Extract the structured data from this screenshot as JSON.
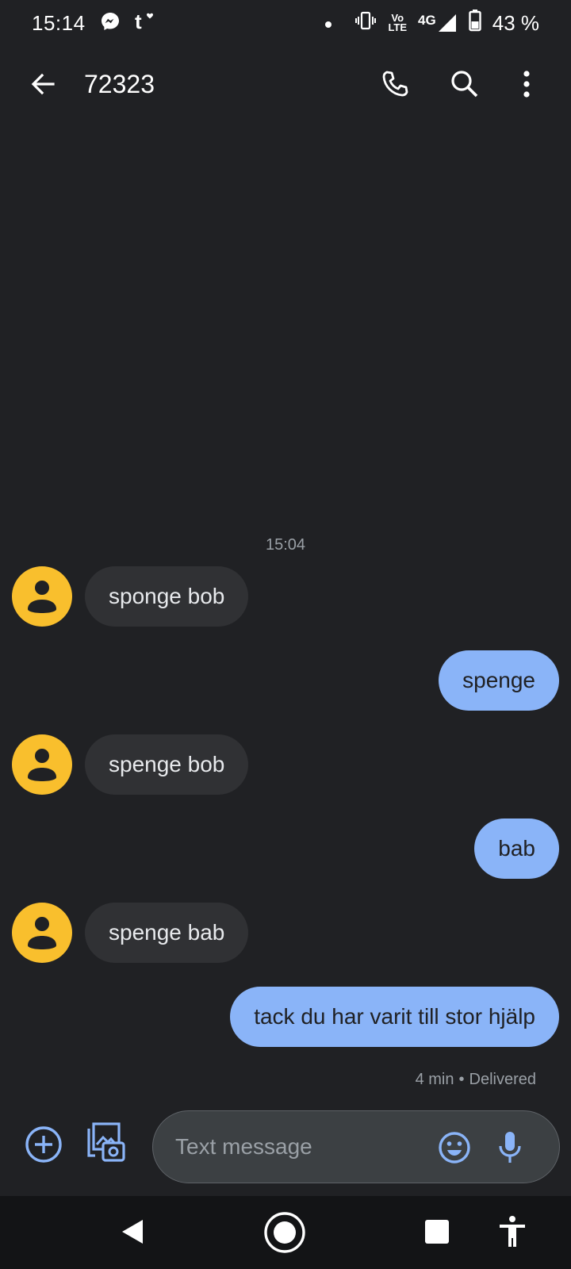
{
  "status_bar": {
    "time": "15:14",
    "network": "4G",
    "volte_top": "Vo",
    "volte_bottom": "LTE",
    "battery": "43 %",
    "icons": [
      "messenger-icon",
      "tumblr-icon",
      "dot-icon",
      "vibrate-icon",
      "volte-icon",
      "signal-icon",
      "battery-icon"
    ]
  },
  "app_bar": {
    "title": "72323",
    "icons": [
      "back-arrow-icon",
      "phone-icon",
      "search-icon",
      "more-vert-icon"
    ]
  },
  "conversation": {
    "timestamp": "15:04",
    "messages": [
      {
        "direction": "incoming",
        "text": "sponge bob"
      },
      {
        "direction": "outgoing",
        "text": "spenge"
      },
      {
        "direction": "incoming",
        "text": "spenge bob"
      },
      {
        "direction": "outgoing",
        "text": "bab"
      },
      {
        "direction": "incoming",
        "text": "spenge bab"
      },
      {
        "direction": "outgoing",
        "text": "tack du har varit till stor hjälp"
      }
    ],
    "delivery_time": "4 min",
    "delivery_separator": "•",
    "delivery_status": "Delivered"
  },
  "compose": {
    "placeholder": "Text message",
    "value": "",
    "icons": [
      "add-circle-icon",
      "media-gallery-icon",
      "emoji-icon",
      "microphone-icon"
    ]
  },
  "nav_bar": {
    "icons": [
      "nav-back-icon",
      "nav-home-icon",
      "nav-recents-icon",
      "accessibility-icon"
    ]
  },
  "colors": {
    "background": "#202124",
    "incoming_bubble": "#303134",
    "outgoing_bubble": "#8ab4f8",
    "avatar": "#f9bf2d",
    "accent": "#8ab4f8"
  }
}
